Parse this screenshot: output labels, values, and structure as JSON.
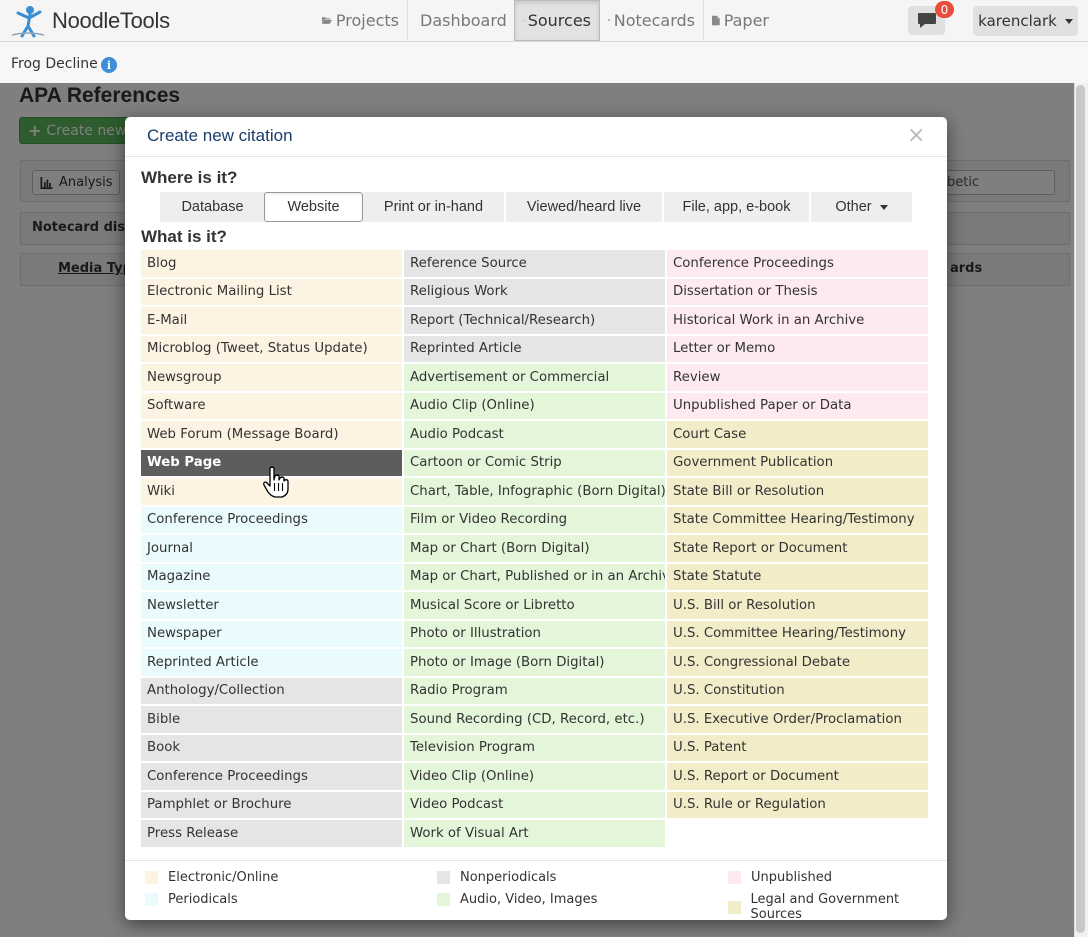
{
  "nav": {
    "brand": "NoodleTools",
    "tabs": [
      {
        "label": "Projects",
        "icon": "folder-open-icon"
      },
      {
        "label": "Dashboard",
        "icon": "bar-chart-icon"
      },
      {
        "label": "Sources",
        "icon": "list-icon"
      },
      {
        "label": "Notecards",
        "icon": "grid-icon"
      },
      {
        "label": "Paper",
        "icon": "file-icon"
      }
    ],
    "active_tab": "Sources",
    "chat_badge": "0",
    "user": "karenclark"
  },
  "project": {
    "name": "Frog Decline"
  },
  "page": {
    "title": "APA References",
    "create_button": "Create new",
    "analysis_button": "Analysis",
    "sort_fragment": "abetic",
    "notecard_fragment": "Notecard disp",
    "media_type_fragment": "Media Typ",
    "cards_fragment": "ards"
  },
  "modal": {
    "title": "Create new citation",
    "close": "×",
    "where_heading": "Where is it?",
    "where_tabs": [
      "Database",
      "Website",
      "Print or in-hand",
      "Viewed/heard live",
      "File, app, e-book",
      "Other"
    ],
    "where_selected": "Website",
    "what_heading": "What is it?",
    "columns": [
      [
        {
          "label": "Blog",
          "cat": "electronic"
        },
        {
          "label": "Electronic Mailing List",
          "cat": "electronic"
        },
        {
          "label": "E-Mail",
          "cat": "electronic"
        },
        {
          "label": "Microblog (Tweet, Status Update)",
          "cat": "electronic"
        },
        {
          "label": "Newsgroup",
          "cat": "electronic"
        },
        {
          "label": "Software",
          "cat": "electronic"
        },
        {
          "label": "Web Forum (Message Board)",
          "cat": "electronic"
        },
        {
          "label": "Web Page",
          "cat": "electronic",
          "active": true
        },
        {
          "label": "Wiki",
          "cat": "electronic"
        },
        {
          "label": "Conference Proceedings",
          "cat": "periodical"
        },
        {
          "label": "Journal",
          "cat": "periodical"
        },
        {
          "label": "Magazine",
          "cat": "periodical"
        },
        {
          "label": "Newsletter",
          "cat": "periodical"
        },
        {
          "label": "Newspaper",
          "cat": "periodical"
        },
        {
          "label": "Reprinted Article",
          "cat": "periodical"
        },
        {
          "label": "Anthology/Collection",
          "cat": "nonperiodical"
        },
        {
          "label": "Bible",
          "cat": "nonperiodical"
        },
        {
          "label": "Book",
          "cat": "nonperiodical"
        },
        {
          "label": "Conference Proceedings",
          "cat": "nonperiodical"
        },
        {
          "label": "Pamphlet or Brochure",
          "cat": "nonperiodical"
        },
        {
          "label": "Press Release",
          "cat": "nonperiodical"
        }
      ],
      [
        {
          "label": "Reference Source",
          "cat": "nonperiodical"
        },
        {
          "label": "Religious Work",
          "cat": "nonperiodical"
        },
        {
          "label": "Report (Technical/Research)",
          "cat": "nonperiodical"
        },
        {
          "label": "Reprinted Article",
          "cat": "nonperiodical"
        },
        {
          "label": "Advertisement or Commercial",
          "cat": "audio"
        },
        {
          "label": "Audio Clip (Online)",
          "cat": "audio"
        },
        {
          "label": "Audio Podcast",
          "cat": "audio"
        },
        {
          "label": "Cartoon or Comic Strip",
          "cat": "audio"
        },
        {
          "label": "Chart, Table, Infographic (Born Digital)",
          "cat": "audio"
        },
        {
          "label": "Film or Video Recording",
          "cat": "audio"
        },
        {
          "label": "Map or Chart (Born Digital)",
          "cat": "audio"
        },
        {
          "label": "Map or Chart, Published or in an Archive",
          "cat": "audio"
        },
        {
          "label": "Musical Score or Libretto",
          "cat": "audio"
        },
        {
          "label": "Photo or Illustration",
          "cat": "audio"
        },
        {
          "label": "Photo or Image (Born Digital)",
          "cat": "audio"
        },
        {
          "label": "Radio Program",
          "cat": "audio"
        },
        {
          "label": "Sound Recording (CD, Record, etc.)",
          "cat": "audio"
        },
        {
          "label": "Television Program",
          "cat": "audio"
        },
        {
          "label": "Video Clip (Online)",
          "cat": "audio"
        },
        {
          "label": "Video Podcast",
          "cat": "audio"
        },
        {
          "label": "Work of Visual Art",
          "cat": "audio"
        }
      ],
      [
        {
          "label": "Conference Proceedings",
          "cat": "unpublished"
        },
        {
          "label": "Dissertation or Thesis",
          "cat": "unpublished"
        },
        {
          "label": "Historical Work in an Archive",
          "cat": "unpublished"
        },
        {
          "label": "Letter or Memo",
          "cat": "unpublished"
        },
        {
          "label": "Review",
          "cat": "unpublished"
        },
        {
          "label": "Unpublished Paper or Data",
          "cat": "unpublished"
        },
        {
          "label": "Court Case",
          "cat": "legal"
        },
        {
          "label": "Government Publication",
          "cat": "legal"
        },
        {
          "label": "State Bill or Resolution",
          "cat": "legal"
        },
        {
          "label": "State Committee Hearing/Testimony",
          "cat": "legal"
        },
        {
          "label": "State Report or Document",
          "cat": "legal"
        },
        {
          "label": "State Statute",
          "cat": "legal"
        },
        {
          "label": "U.S. Bill or Resolution",
          "cat": "legal"
        },
        {
          "label": "U.S. Committee Hearing/Testimony",
          "cat": "legal"
        },
        {
          "label": "U.S. Congressional Debate",
          "cat": "legal"
        },
        {
          "label": "U.S. Constitution",
          "cat": "legal"
        },
        {
          "label": "U.S. Executive Order/Proclamation",
          "cat": "legal"
        },
        {
          "label": "U.S. Patent",
          "cat": "legal"
        },
        {
          "label": "U.S. Report or Document",
          "cat": "legal"
        },
        {
          "label": "U.S. Rule or Regulation",
          "cat": "legal"
        }
      ]
    ],
    "legend": [
      {
        "label": "Electronic/Online",
        "cat": "electronic"
      },
      {
        "label": "Periodicals",
        "cat": "periodical"
      },
      {
        "label": "Nonperiodicals",
        "cat": "nonperiodical"
      },
      {
        "label": "Audio, Video, Images",
        "cat": "audio"
      },
      {
        "label": "Unpublished",
        "cat": "unpublished"
      },
      {
        "label": "Legal and Government Sources",
        "cat": "legal"
      }
    ]
  },
  "colors": {
    "electronic": "#fdf3e3",
    "periodical": "#e9fbfd",
    "nonperiodical": "#e5e5e5",
    "audio": "#e4f6d9",
    "unpublished": "#fdeaee",
    "legal": "#f2ecc8",
    "active": "#5d5d5d"
  }
}
